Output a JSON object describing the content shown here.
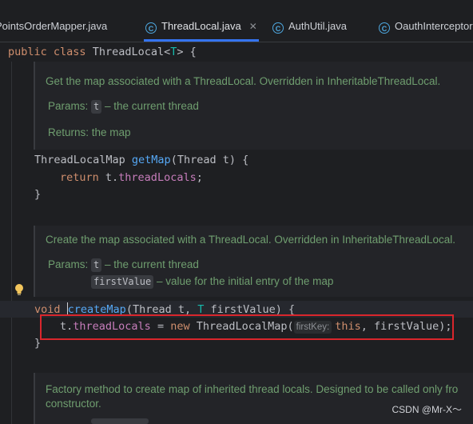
{
  "tabs": [
    {
      "label": "PointsOrderMapper.java",
      "icon": "class-icon"
    },
    {
      "label": "ThreadLocal.java",
      "icon": "class-icon",
      "active": true
    },
    {
      "label": "AuthUtil.java",
      "icon": "class-icon"
    },
    {
      "label": "OauthInterceptor",
      "icon": "class-icon"
    }
  ],
  "class_decl": {
    "kw1": "public",
    "kw2": "class",
    "name": "ThreadLocal",
    "type_param": "T",
    "tail": " {"
  },
  "doc1": {
    "summary": "Get the map associated with a ThreadLocal. Overridden in InheritableThreadLocal.",
    "params_label": "Params:",
    "param": "t",
    "param_desc": "– the current thread",
    "returns": "Returns: the map"
  },
  "getmap": {
    "type": "ThreadLocalMap ",
    "name": "getMap",
    "args": "(Thread t) {",
    "ret_kw": "return",
    "ret_obj": " t.",
    "ret_field": "threadLocals",
    "ret_end": ";",
    "close": "}"
  },
  "doc2": {
    "summary": "Create the map associated with a ThreadLocal. Overridden in InheritableThreadLocal.",
    "params_label": "Params:",
    "param1": "t",
    "param1_desc": "– the current thread",
    "param2": "firstValue",
    "param2_desc": "– value for the initial entry of the map"
  },
  "createmap": {
    "kw": "void",
    "name": "createMap",
    "args_a": "(Thread t, ",
    "tp": "T",
    "args_b": " firstValue) {",
    "body_obj": "t.",
    "body_field": "threadLocals",
    "body_eq": " = ",
    "body_new": "new",
    "body_ctor": " ThreadLocalMap(",
    "hint": "firstKey:",
    "body_this": "this",
    "body_end": ", firstValue);",
    "close": "}"
  },
  "doc3": {
    "line1": "Factory method to create map of inherited thread locals. Designed to be called only fro",
    "line2": "constructor."
  },
  "watermark": "CSDN @Mr-X～"
}
